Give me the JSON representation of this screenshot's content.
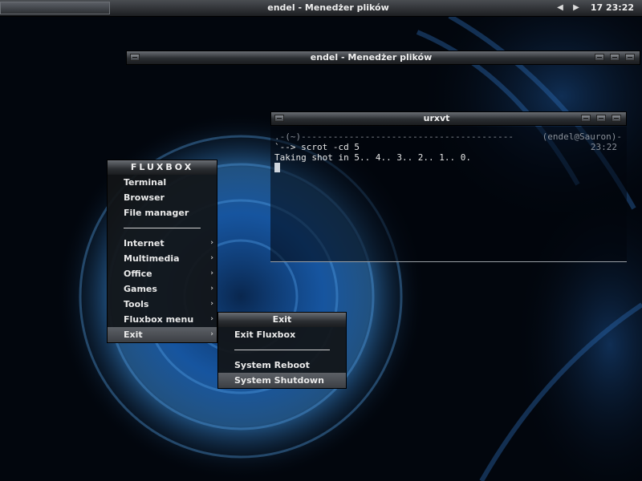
{
  "colors": {
    "accent_blue": "#3a8fe0",
    "bar_dark": "#1c1e21",
    "menu_bg": "#121417",
    "highlight": "#4c5056"
  },
  "toolbar": {
    "title": "endel - Menedżer plików",
    "prev_icon": "triangle-left-icon",
    "next_icon": "triangle-right-icon",
    "prev_glyph": "◀",
    "next_glyph": "▶",
    "clock": "17 23:22"
  },
  "file_manager_window": {
    "title": "endel - Menedżer plików"
  },
  "terminal": {
    "title": "urxvt",
    "line1_left": ".-(~)----------------------------------------",
    "line1_right": "(endel@Sauron)-",
    "line2_left": "`--> scrot -cd 5",
    "line2_right": "23:22",
    "line3": "Taking shot in 5.. 4.. 3.. 2.. 1.. 0."
  },
  "root_menu": {
    "title": "FLUXBOX",
    "items": [
      {
        "label": "Terminal",
        "submenu": false
      },
      {
        "label": "Browser",
        "submenu": false
      },
      {
        "label": "File manager",
        "submenu": false
      },
      {
        "separator": true
      },
      {
        "label": "Internet",
        "submenu": true
      },
      {
        "label": "Multimedia",
        "submenu": true
      },
      {
        "label": "Office",
        "submenu": true
      },
      {
        "label": "Games",
        "submenu": true
      },
      {
        "label": "Tools",
        "submenu": true
      },
      {
        "label": "Fluxbox menu",
        "submenu": true
      },
      {
        "label": "Exit",
        "submenu": true,
        "active": true
      }
    ]
  },
  "exit_menu": {
    "title": "Exit",
    "items": [
      {
        "label": "Exit Fluxbox"
      },
      {
        "separator": true
      },
      {
        "label": "System Reboot"
      },
      {
        "label": "System Shutdown",
        "active": true
      }
    ]
  },
  "submenu_arrow": "›"
}
